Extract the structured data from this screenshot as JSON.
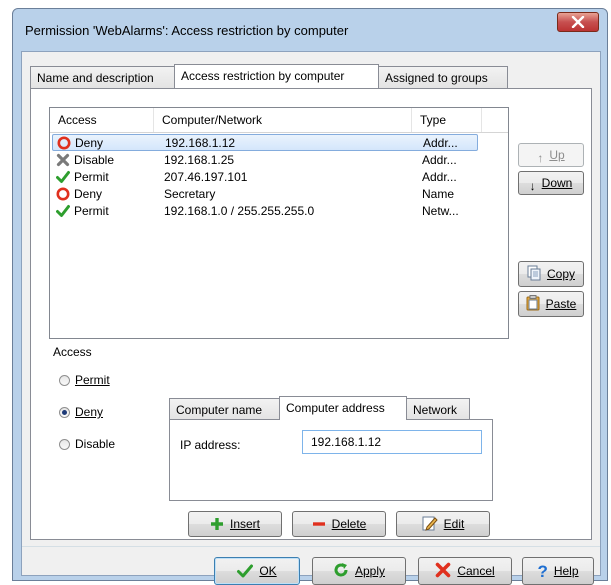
{
  "window": {
    "title": "Permission 'WebAlarms': Access restriction by computer",
    "close_icon": "close-x-icon"
  },
  "tabs": [
    {
      "label": "Name and description",
      "active": false
    },
    {
      "label": "Access restriction by computer",
      "active": true
    },
    {
      "label": "Assigned to groups",
      "active": false
    }
  ],
  "list": {
    "columns": [
      "Access",
      "Computer/Network",
      "Type"
    ],
    "rows": [
      {
        "access": "Deny",
        "icon": "deny-icon",
        "address": "192.168.1.12",
        "type": "Addr...",
        "selected": true
      },
      {
        "access": "Disable",
        "icon": "disable-icon",
        "address": "192.168.1.25",
        "type": "Addr...",
        "selected": false
      },
      {
        "access": "Permit",
        "icon": "permit-icon",
        "address": "207.46.197.101",
        "type": "Addr...",
        "selected": false
      },
      {
        "access": "Deny",
        "icon": "deny-icon",
        "address": "Secretary",
        "type": "Name",
        "selected": false
      },
      {
        "access": "Permit",
        "icon": "permit-icon",
        "address": "192.168.1.0 / 255.255.255.0",
        "type": "Netw...",
        "selected": false
      }
    ]
  },
  "side_buttons": {
    "up": "Up",
    "down": "Down",
    "copy": "Copy",
    "paste": "Paste"
  },
  "access_group": {
    "label": "Access",
    "options": [
      {
        "label": "Permit",
        "checked": false
      },
      {
        "label": "Deny",
        "checked": true
      },
      {
        "label": "Disable",
        "checked": false
      }
    ]
  },
  "subtabs": [
    {
      "label": "Computer name",
      "active": false
    },
    {
      "label": "Computer address",
      "active": true
    },
    {
      "label": "Network",
      "active": false
    }
  ],
  "ip_field": {
    "label": "IP address:",
    "value": "192.168.1.12"
  },
  "action_buttons": {
    "insert": "Insert",
    "delete": "Delete",
    "edit": "Edit"
  },
  "footer_buttons": {
    "ok": "OK",
    "apply": "Apply",
    "cancel": "Cancel",
    "help": "Help"
  },
  "colors": {
    "deny": "#e0301e",
    "permit": "#2e9e2e",
    "disable": "#7a7a7a",
    "selection": "#d4e6fb"
  }
}
